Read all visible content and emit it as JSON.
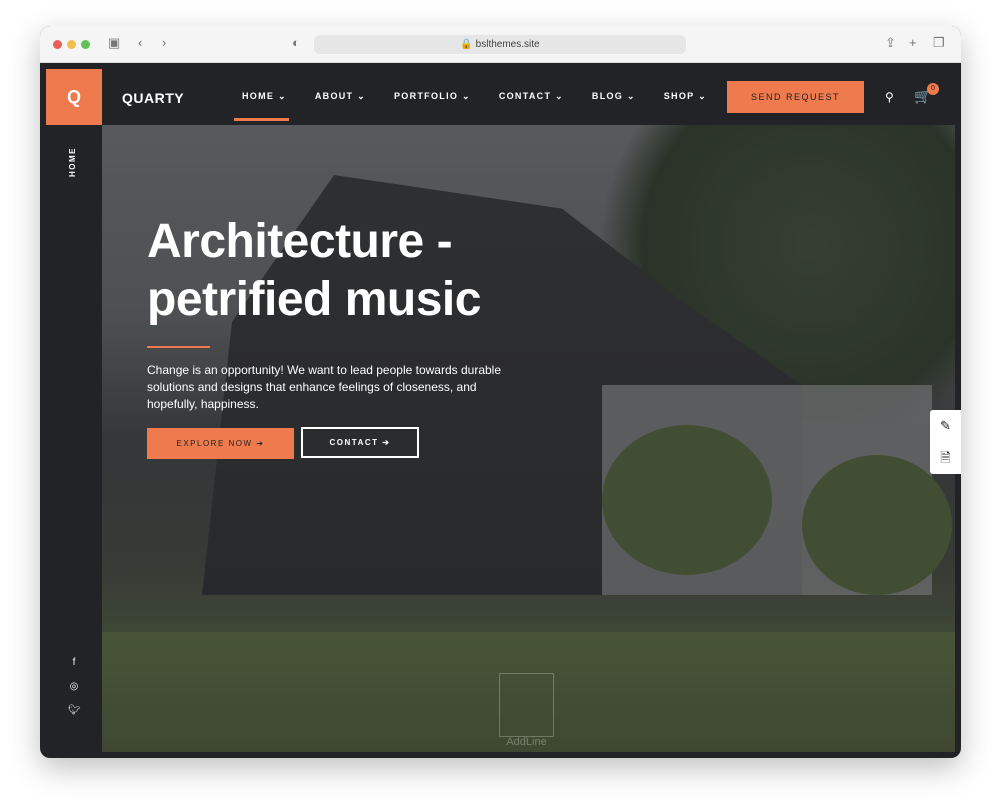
{
  "browser": {
    "url": "bslthemes.site"
  },
  "header": {
    "logo_letter": "Q",
    "brand": "QUARTY",
    "menu": [
      {
        "label": "HOME ⌄"
      },
      {
        "label": "ABOUT ⌄"
      },
      {
        "label": "PORTFOLIO ⌄"
      },
      {
        "label": "CONTACT ⌄"
      },
      {
        "label": "BLOG ⌄"
      },
      {
        "label": "SHOP ⌄"
      }
    ],
    "active": "HOME",
    "send_label": "SEND REQUEST",
    "cart_count": "0"
  },
  "sidebar": {
    "page_label": "HOME",
    "social": [
      "facebook",
      "instagram",
      "twitter"
    ]
  },
  "hero": {
    "title_line1": "Architecture -",
    "title_line2": "petrified music",
    "description": "Change is an opportunity! We want to lead people towards durable solutions and designs that enhance feelings of closeness, and hopefully, happiness.",
    "explore_label": "EXPLORE NOW  ➔",
    "contact_label": "CONTACT  ➔",
    "watermark": "AddLine"
  },
  "colors": {
    "accent": "#ef7a4d",
    "dark": "#222327"
  }
}
